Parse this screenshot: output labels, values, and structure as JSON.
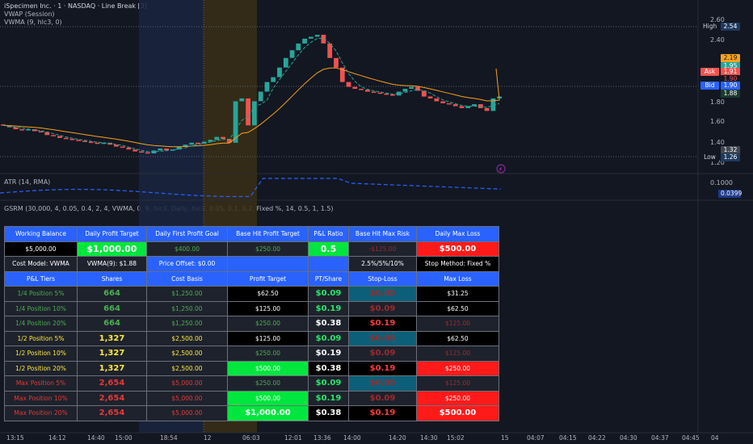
{
  "header": {
    "symbol_line": "iSpecimen Inc. · 1 · NASDAQ · Line Break [3]",
    "indicator_1": "VWAP (Session)",
    "indicator_2": "VWMA (9, hlc3, 0)",
    "atr_legend": "ATR (14, RMA)",
    "gsrm_legend": "GSRM (30,000, 4, 0.05, 0.4, 2, 4, VWMA, 0, 9, hlc3, Daily, hlc3, 0.05, 0.1, 0.2, Fixed %, 14, 0.5, 1, 1.5)"
  },
  "price_axis": {
    "ticks": [
      "2.60",
      "2.40",
      "1.80",
      "1.60",
      "1.40",
      "1.20"
    ],
    "tags": {
      "high_label": "High",
      "high_value": "2.54",
      "ask_label": "Ask",
      "ask_value": "1.91",
      "bid_label": "Bid",
      "bid_value": "1.90",
      "low_label": "Low",
      "low_value": "1.26",
      "orange_value": "2.19",
      "green_value": "1.95",
      "red_value": "1.90",
      "dark_value": "1.88",
      "gray_value": "1.32"
    },
    "atr_ticks": [
      "0.1000"
    ],
    "atr_value": "0.0399"
  },
  "time_axis": {
    "labels": [
      "13:15",
      "14:12",
      "14:40",
      "15:00",
      "18:54",
      "12",
      "06:03",
      "12:01",
      "13:36",
      "14:00",
      "14:20",
      "14:30",
      "15:02",
      "15",
      "04:07",
      "04:15",
      "04:22",
      "04:30",
      "04:37",
      "04:45",
      "04"
    ]
  },
  "table": {
    "headers": [
      "Working Balance",
      "Daily Profit Target",
      "Daily First Profit Goal",
      "Base Hit Profit Target",
      "P&L Ratio",
      "Base Hit Max Risk",
      "Daily Max Loss"
    ],
    "summary": [
      "$5,000.00",
      "$1,000.00",
      "$400.00",
      "$250.00",
      "0.5",
      "-$125.00",
      "$500.00"
    ],
    "info": {
      "cost_model": "Cost Model: VWMA",
      "vwma": "VWMA(9): $1.88",
      "price_offset": "Price Offset: $0.00",
      "pcts": "2.5%/5%/10%",
      "stop_method": "Stop Method: Fixed %"
    },
    "columns": [
      "P&L Tiers",
      "Shares",
      "Cost Basis",
      "Profit Target",
      "PT/Share",
      "Stop-Loss",
      "Max Loss"
    ],
    "rows": [
      {
        "tier": "1/4 Position 5%",
        "shares": "664",
        "basis": "$1,250.00",
        "target": "$62.50",
        "pt": "$0.09",
        "sl": "$0.05",
        "loss": "$31.25"
      },
      {
        "tier": "1/4 Position 10%",
        "shares": "664",
        "basis": "$1,250.00",
        "target": "$125.00",
        "pt": "$0.19",
        "sl": "$0.09",
        "loss": "$62.50"
      },
      {
        "tier": "1/4 Position 20%",
        "shares": "664",
        "basis": "$1,250.00",
        "target": "$250.00",
        "pt": "$0.38",
        "sl": "$0.19",
        "loss": "$125.00"
      },
      {
        "tier": "1/2 Position 5%",
        "shares": "1,327",
        "basis": "$2,500.00",
        "target": "$125.00",
        "pt": "$0.09",
        "sl": "$0.05",
        "loss": "$62.50"
      },
      {
        "tier": "1/2 Position 10%",
        "shares": "1,327",
        "basis": "$2,500.00",
        "target": "$250.00",
        "pt": "$0.19",
        "sl": "$0.09",
        "loss": "$125.00"
      },
      {
        "tier": "1/2 Position 20%",
        "shares": "1,327",
        "basis": "$2,500.00",
        "target": "$500.00",
        "pt": "$0.38",
        "sl": "$0.19",
        "loss": "$250.00"
      },
      {
        "tier": "Max Position 5%",
        "shares": "2,654",
        "basis": "$5,000.00",
        "target": "$250.00",
        "pt": "$0.09",
        "sl": "$0.05",
        "loss": "$125.00"
      },
      {
        "tier": "Max Position 10%",
        "shares": "2,654",
        "basis": "$5,000.00",
        "target": "$500.00",
        "pt": "$0.19",
        "sl": "$0.09",
        "loss": "$250.00"
      },
      {
        "tier": "Max Position 20%",
        "shares": "2,654",
        "basis": "$5,000.00",
        "target": "$1,000.00",
        "pt": "$0.38",
        "sl": "$0.19",
        "loss": "$500.00"
      }
    ]
  },
  "colors": {
    "background": "#131722",
    "bull": "#26a69a",
    "bear": "#ef5350",
    "header_blue": "#2962ff",
    "vwap_orange": "#f7a21b",
    "vwma_teal": "#26a69a",
    "atr_blue": "#2962ff"
  },
  "chart_data": {
    "type": "candlestick",
    "price_ticks": [
      2.6,
      2.4,
      1.8,
      1.6,
      1.4,
      1.2
    ],
    "ylim": [
      1.1,
      2.65
    ],
    "line_break_closes": [
      1.6,
      1.58,
      1.56,
      1.55,
      1.56,
      1.54,
      1.53,
      1.5,
      1.49,
      1.47,
      1.46,
      1.45,
      1.44,
      1.43,
      1.42,
      1.41,
      1.42,
      1.4,
      1.38,
      1.37,
      1.35,
      1.33,
      1.32,
      1.31,
      1.34,
      1.36,
      1.34,
      1.35,
      1.38,
      1.4,
      1.42,
      1.41,
      1.43,
      1.45,
      1.48,
      1.46,
      1.42,
      1.85,
      1.88,
      1.6,
      1.85,
      1.95,
      2.05,
      2.1,
      2.2,
      2.3,
      2.38,
      2.45,
      2.5,
      2.52,
      2.54,
      2.45,
      2.3,
      2.2,
      2.05,
      2.0,
      1.98,
      1.97,
      1.95,
      1.94,
      1.93,
      1.92,
      1.91,
      1.95,
      1.98,
      2.0,
      1.96,
      1.9,
      1.88,
      1.85,
      1.83,
      1.82,
      1.8,
      1.78,
      1.8,
      1.82,
      1.78,
      1.75,
      1.88,
      1.9
    ]
  }
}
